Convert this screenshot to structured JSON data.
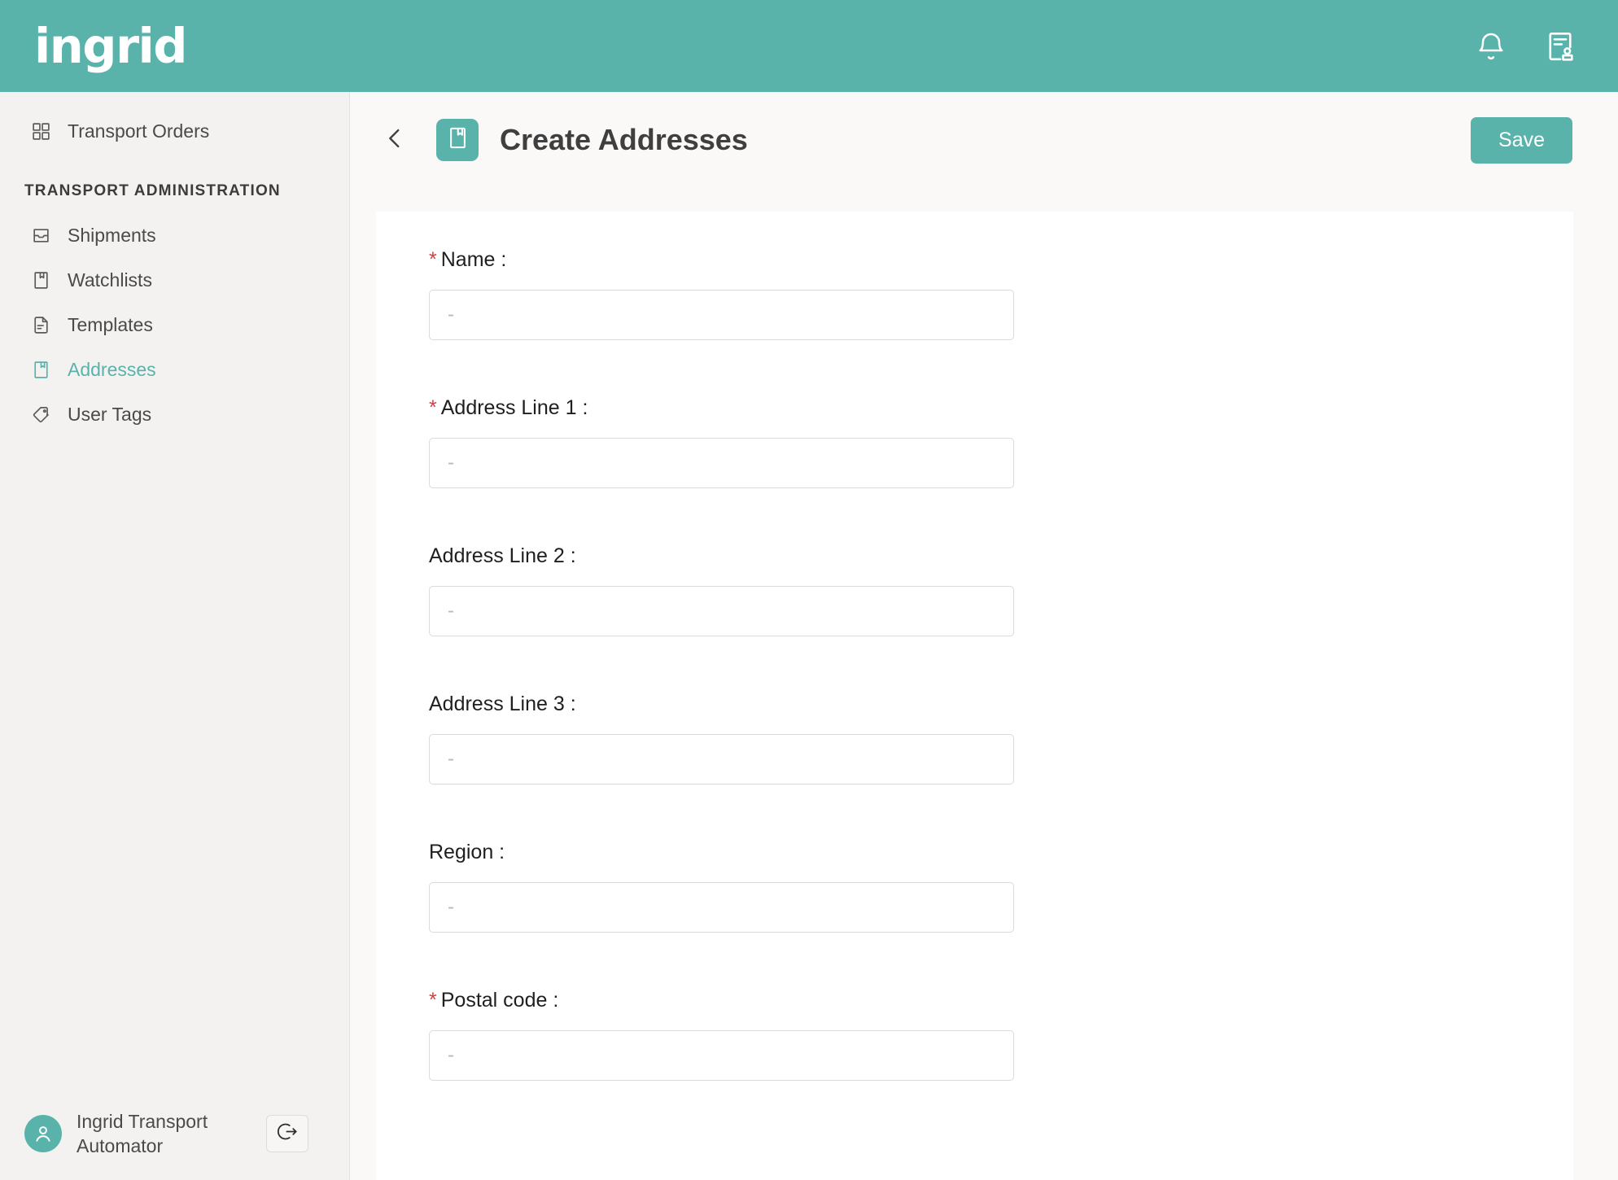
{
  "brand": {
    "logo_text": "ingrid",
    "accent_color": "#59b3ab",
    "required_color": "#e0393e"
  },
  "topbar": {
    "notifications_icon": "bell-icon",
    "account_icon": "contract-person-icon"
  },
  "sidebar": {
    "primary": [
      {
        "label": "Transport Orders",
        "icon": "grid-icon",
        "active": false
      }
    ],
    "section_title": "TRANSPORT ADMINISTRATION",
    "items": [
      {
        "label": "Shipments",
        "icon": "inbox-icon",
        "active": false
      },
      {
        "label": "Watchlists",
        "icon": "bookmark-doc-icon",
        "active": false
      },
      {
        "label": "Templates",
        "icon": "file-lines-icon",
        "active": false
      },
      {
        "label": "Addresses",
        "icon": "address-book-icon",
        "active": true
      },
      {
        "label": "User Tags",
        "icon": "tag-icon",
        "active": false
      }
    ],
    "user": {
      "name": "Ingrid Transport Automator",
      "avatar_icon": "user-avatar-icon",
      "logout_icon": "logout-icon"
    }
  },
  "page": {
    "back_icon": "chevron-left-icon",
    "title_icon": "address-book-icon",
    "title": "Create Addresses",
    "save_label": "Save"
  },
  "form": {
    "fields": [
      {
        "label": "Name :",
        "required": true,
        "value": "",
        "placeholder": "-"
      },
      {
        "label": "Address Line 1 :",
        "required": true,
        "value": "",
        "placeholder": "-"
      },
      {
        "label": "Address Line 2 :",
        "required": false,
        "value": "",
        "placeholder": "-"
      },
      {
        "label": "Address Line 3 :",
        "required": false,
        "value": "",
        "placeholder": "-"
      },
      {
        "label": "Region :",
        "required": false,
        "value": "",
        "placeholder": "-"
      },
      {
        "label": "Postal code :",
        "required": true,
        "value": "",
        "placeholder": "-"
      }
    ]
  }
}
